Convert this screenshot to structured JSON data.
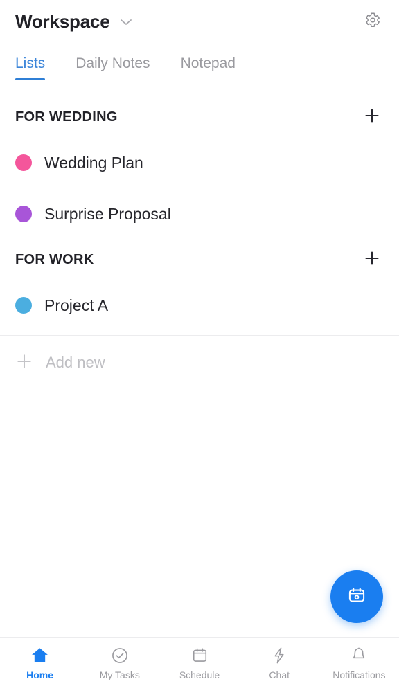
{
  "header": {
    "workspace_title": "Workspace",
    "chevron_icon": "chevron-down-icon",
    "settings_icon": "gear-icon"
  },
  "tabs": [
    {
      "label": "Lists",
      "active": true
    },
    {
      "label": "Daily Notes",
      "active": false
    },
    {
      "label": "Notepad",
      "active": false
    }
  ],
  "sections": [
    {
      "title": "FOR WEDDING",
      "add_icon": "plus-icon",
      "items": [
        {
          "label": "Wedding Plan",
          "color": "#F4569B"
        },
        {
          "label": "Surprise Proposal",
          "color": "#A855D8"
        }
      ]
    },
    {
      "title": "FOR WORK",
      "add_icon": "plus-icon",
      "items": [
        {
          "label": "Project A",
          "color": "#4BAEE0"
        }
      ]
    }
  ],
  "add_new": {
    "label": "Add new",
    "icon": "plus-icon"
  },
  "fab": {
    "icon": "calendar-radio-icon",
    "color": "#1A7EF0"
  },
  "bottom_nav": [
    {
      "label": "Home",
      "icon": "home-icon",
      "active": true
    },
    {
      "label": "My Tasks",
      "icon": "check-circle-icon",
      "active": false
    },
    {
      "label": "Schedule",
      "icon": "calendar-icon",
      "active": false
    },
    {
      "label": "Chat",
      "icon": "lightning-bolt-icon",
      "active": false
    },
    {
      "label": "Notifications",
      "icon": "bell-icon",
      "active": false
    }
  ],
  "colors": {
    "accent": "#1A7EF0",
    "tab_active": "#3B85D9",
    "muted": "#9A9A9F",
    "text": "#222228"
  }
}
